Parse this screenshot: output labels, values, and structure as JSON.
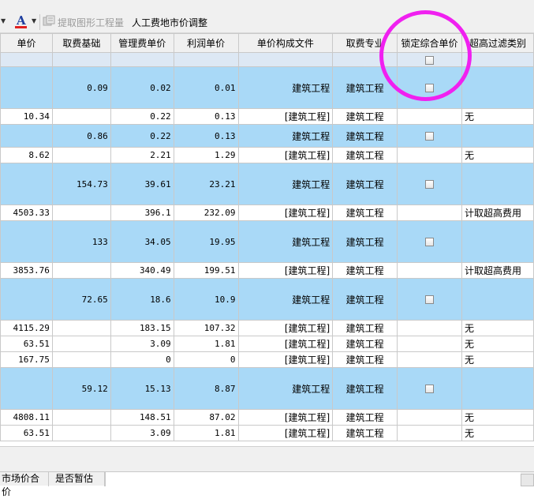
{
  "toolbar": {
    "font_color_icon": "font-color-icon",
    "font_letter": "A",
    "extract_graph_label": "提取图形工程量",
    "labor_adjust_label": "人工费地市价调整"
  },
  "columns": [
    "单价",
    "取费基础",
    "管理费单价",
    "利润单价",
    "单价构成文件",
    "取费专业",
    "锁定综合单价",
    "超高过滤类别"
  ],
  "rows": [
    {
      "kind": "blank",
      "price": "",
      "base": "",
      "mgmt": "",
      "profit": "",
      "file": "",
      "major": "",
      "lock": true,
      "filter": ""
    },
    {
      "kind": "hl",
      "price": "",
      "base": "0.09",
      "mgmt": "0.02",
      "profit": "0.01",
      "file": "建筑工程",
      "major": "建筑工程",
      "lock": true,
      "filter": ""
    },
    {
      "kind": "plain",
      "price": "10.34",
      "base": "",
      "mgmt": "0.22",
      "profit": "0.13",
      "file": "[建筑工程]",
      "major": "建筑工程",
      "lock": false,
      "filter": "无"
    },
    {
      "kind": "hl",
      "price": "",
      "base": "0.86",
      "mgmt": "0.22",
      "profit": "0.13",
      "file": "建筑工程",
      "major": "建筑工程",
      "lock": true,
      "filter": ""
    },
    {
      "kind": "plain",
      "price": "8.62",
      "base": "",
      "mgmt": "2.21",
      "profit": "1.29",
      "file": "[建筑工程]",
      "major": "建筑工程",
      "lock": false,
      "filter": "无"
    },
    {
      "kind": "hl",
      "price": "",
      "base": "154.73",
      "mgmt": "39.61",
      "profit": "23.21",
      "file": "建筑工程",
      "major": "建筑工程",
      "lock": true,
      "filter": ""
    },
    {
      "kind": "plain",
      "price": "4503.33",
      "base": "",
      "mgmt": "396.1",
      "profit": "232.09",
      "file": "[建筑工程]",
      "major": "建筑工程",
      "lock": false,
      "filter": "计取超高费用"
    },
    {
      "kind": "hl",
      "price": "",
      "base": "133",
      "mgmt": "34.05",
      "profit": "19.95",
      "file": "建筑工程",
      "major": "建筑工程",
      "lock": true,
      "filter": ""
    },
    {
      "kind": "plain",
      "price": "3853.76",
      "base": "",
      "mgmt": "340.49",
      "profit": "199.51",
      "file": "[建筑工程]",
      "major": "建筑工程",
      "lock": false,
      "filter": "计取超高费用"
    },
    {
      "kind": "hl",
      "price": "",
      "base": "72.65",
      "mgmt": "18.6",
      "profit": "10.9",
      "file": "建筑工程",
      "major": "建筑工程",
      "lock": true,
      "filter": ""
    },
    {
      "kind": "plain",
      "price": "4115.29",
      "base": "",
      "mgmt": "183.15",
      "profit": "107.32",
      "file": "[建筑工程]",
      "major": "建筑工程",
      "lock": false,
      "filter": "无"
    },
    {
      "kind": "plain",
      "price": "63.51",
      "base": "",
      "mgmt": "3.09",
      "profit": "1.81",
      "file": "[建筑工程]",
      "major": "建筑工程",
      "lock": false,
      "filter": "无"
    },
    {
      "kind": "plain",
      "price": "167.75",
      "base": "",
      "mgmt": "0",
      "profit": "0",
      "file": "[建筑工程]",
      "major": "建筑工程",
      "lock": false,
      "filter": "无"
    },
    {
      "kind": "hl",
      "price": "",
      "base": "59.12",
      "mgmt": "15.13",
      "profit": "8.87",
      "file": "建筑工程",
      "major": "建筑工程",
      "lock": true,
      "filter": ""
    },
    {
      "kind": "plain",
      "price": "4808.11",
      "base": "",
      "mgmt": "148.51",
      "profit": "87.02",
      "file": "[建筑工程]",
      "major": "建筑工程",
      "lock": false,
      "filter": "无"
    },
    {
      "kind": "plain",
      "price": "63.51",
      "base": "",
      "mgmt": "3.09",
      "profit": "1.81",
      "file": "[建筑工程]",
      "major": "建筑工程",
      "lock": false,
      "filter": "无"
    }
  ],
  "bottom_tabs": [
    "市场价合价",
    "是否暂估"
  ],
  "colors": {
    "highlight_row": "#a9d9f7",
    "blank_row": "#dde8f4",
    "annotation": "#f020f0",
    "header_bg": "#f0f0f0"
  }
}
